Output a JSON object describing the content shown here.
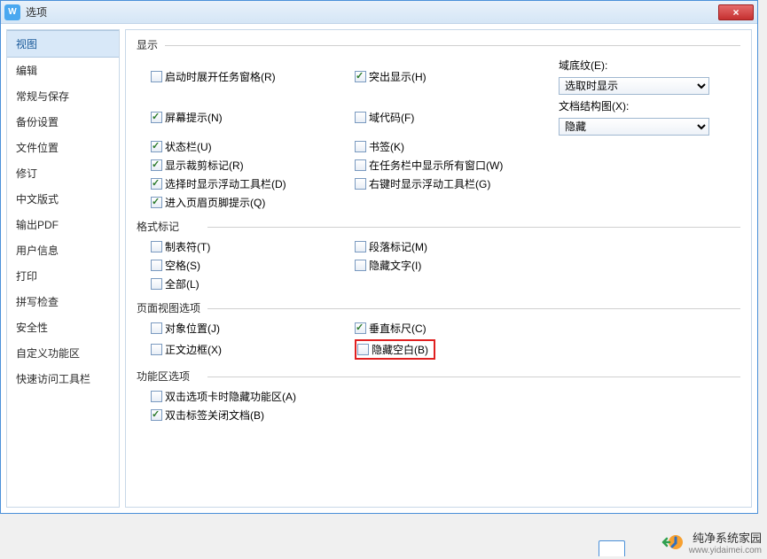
{
  "title": "选项",
  "close": "×",
  "sidebar": [
    "视图",
    "编辑",
    "常规与保存",
    "备份设置",
    "文件位置",
    "修订",
    "中文版式",
    "输出PDF",
    "用户信息",
    "打印",
    "拼写检查",
    "安全性",
    "自定义功能区",
    "快速访问工具栏"
  ],
  "sidebar_active": 0,
  "groups": {
    "display": {
      "title": "显示",
      "col1": [
        {
          "label": "启动时展开任务窗格(R)",
          "checked": false
        },
        {
          "label": "屏幕提示(N)",
          "checked": true
        },
        {
          "label": "状态栏(U)",
          "checked": true
        },
        {
          "label": "显示裁剪标记(R)",
          "checked": true
        },
        {
          "label": "选择时显示浮动工具栏(D)",
          "checked": true
        },
        {
          "label": "进入页眉页脚提示(Q)",
          "checked": true
        }
      ],
      "col2": [
        {
          "label": "突出显示(H)",
          "checked": true
        },
        {
          "label": "域代码(F)",
          "checked": false
        },
        {
          "label": "书签(K)",
          "checked": false
        },
        {
          "label": "在任务栏中显示所有窗口(W)",
          "checked": false
        },
        {
          "label": "右键时显示浮动工具栏(G)",
          "checked": false
        }
      ],
      "col3": [
        {
          "label": "域底纹(E):",
          "value": "选取时显示"
        },
        {
          "label": "文档结构图(X):",
          "value": "隐藏"
        }
      ]
    },
    "marks": {
      "title": "格式标记",
      "col1": [
        {
          "label": "制表符(T)",
          "checked": false
        },
        {
          "label": "空格(S)",
          "checked": false
        },
        {
          "label": "全部(L)",
          "checked": false
        }
      ],
      "col2": [
        {
          "label": "段落标记(M)",
          "checked": false
        },
        {
          "label": "隐藏文字(I)",
          "checked": false
        }
      ]
    },
    "pageview": {
      "title": "页面视图选项",
      "col1": [
        {
          "label": "对象位置(J)",
          "checked": false
        },
        {
          "label": "正文边框(X)",
          "checked": false
        }
      ],
      "col2": [
        {
          "label": "垂直标尺(C)",
          "checked": true
        },
        {
          "label": "隐藏空白(B)",
          "checked": false,
          "highlight": true
        }
      ]
    },
    "ribbon": {
      "title": "功能区选项",
      "items": [
        {
          "label": "双击选项卡时隐藏功能区(A)",
          "checked": false
        },
        {
          "label": "双击标签关闭文档(B)",
          "checked": true
        }
      ]
    }
  },
  "watermark": {
    "main": "纯净系统家园",
    "sub": "www.yidaimei.com"
  }
}
